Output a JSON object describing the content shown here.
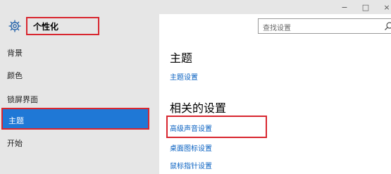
{
  "window": {
    "minimize_glyph": "−",
    "maximize_glyph": "□",
    "close_glyph": "×"
  },
  "sidebar": {
    "title": "个性化",
    "icon": "gear-icon",
    "items": [
      {
        "label": "背景"
      },
      {
        "label": "颜色"
      },
      {
        "label": "锁屏界面"
      },
      {
        "label": "主题"
      },
      {
        "label": "开始"
      }
    ],
    "selected_index": 3
  },
  "search": {
    "placeholder": "查找设置",
    "icon": "search-icon"
  },
  "main": {
    "section_title": "主题",
    "theme_settings_link": "主题设置",
    "related_title": "相关的设置",
    "related_links": [
      {
        "label": "高级声音设置"
      },
      {
        "label": "桌面图标设置"
      },
      {
        "label": "鼠标指针设置"
      }
    ]
  },
  "colors": {
    "highlight_box": "#d8262f",
    "selected_item": "#1f78d6",
    "link": "#0a62c2",
    "sidebar_bg": "#e6e6e6"
  }
}
